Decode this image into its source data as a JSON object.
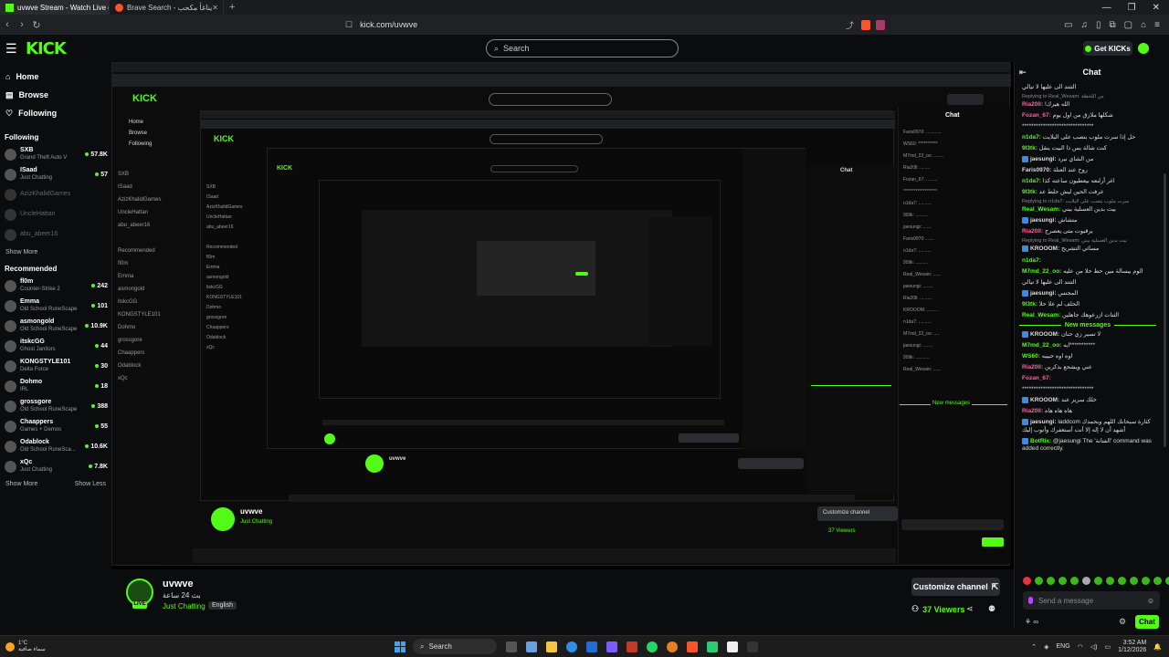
{
  "browser": {
    "tabs": [
      {
        "title": "uvwve Stream - Watch Live on K",
        "active": true
      },
      {
        "title": "Brave Search - يناغأ مكحب",
        "active": false
      }
    ],
    "new_tab": "+",
    "url": "kick.com/uvwve",
    "window_controls": [
      "—",
      "❐",
      "✕"
    ]
  },
  "header": {
    "logo": "KICK",
    "search_placeholder": "Search",
    "get_kicks": "Get KICKs"
  },
  "sidebar": {
    "nav": [
      {
        "label": "Home",
        "icon": "home-icon"
      },
      {
        "label": "Browse",
        "icon": "browse-icon"
      },
      {
        "label": "Following",
        "icon": "heart-icon"
      }
    ],
    "following_title": "Following",
    "following": [
      {
        "name": "SXB",
        "category": "Grand Theft Auto V",
        "viewers": "57.8K",
        "live": true
      },
      {
        "name": "ISaad",
        "category": "Just Chatting",
        "viewers": "57",
        "live": true
      },
      {
        "name": "AzizKhalidGames",
        "category": "",
        "viewers": "",
        "live": false
      },
      {
        "name": "UncleHattan",
        "category": "",
        "viewers": "",
        "live": false
      },
      {
        "name": "abu_abeer16",
        "category": "",
        "viewers": "",
        "live": false
      }
    ],
    "following_show_more": "Show More",
    "recommended_title": "Recommended",
    "recommended": [
      {
        "name": "fl0m",
        "category": "Counter-Strike 2",
        "viewers": "242"
      },
      {
        "name": "Emma",
        "category": "Old School RuneScape",
        "viewers": "101"
      },
      {
        "name": "asmongold",
        "category": "Old School RuneScape",
        "viewers": "10.9K"
      },
      {
        "name": "itskcGG",
        "category": "Ghost Janitors",
        "viewers": "44"
      },
      {
        "name": "KONGSTYLE101",
        "category": "Delta Force",
        "viewers": "30"
      },
      {
        "name": "Dohmo",
        "category": "IRL",
        "viewers": "18"
      },
      {
        "name": "grossgore",
        "category": "Old School RuneScape",
        "viewers": "388"
      },
      {
        "name": "Chaappers",
        "category": "Games + Demos",
        "viewers": "55"
      },
      {
        "name": "Odablock",
        "category": "Old School RuneSca...",
        "viewers": "10.6K"
      },
      {
        "name": "xQc",
        "category": "Just Chatting",
        "viewers": "7.8K"
      }
    ],
    "rec_show_more": "Show More",
    "rec_show_less": "Show Less"
  },
  "stream": {
    "streamer": "uvwve",
    "live_badge": "LIVE",
    "title": "بث 24 ساعة",
    "category": "Just Chatting",
    "language": "English",
    "customize": "Customize channel",
    "viewers": "37 Viewers"
  },
  "chat": {
    "title": "Chat",
    "messages": [
      {
        "reply": "",
        "user": "",
        "color": "#ddd",
        "text": "التتند الى عليها لا تيالي",
        "badge": false
      },
      {
        "reply": "Replying to Real_Wesam: من اللحظة",
        "user": "Ria20ll:",
        "color": "#ff5fa2",
        "text": "الله هيرك!",
        "badge": false
      },
      {
        "reply": "",
        "user": "Fozan_67:",
        "color": "#ff5fa2",
        "text": "شكلها ملازق من اول يوم",
        "badge": false
      },
      {
        "reply": "",
        "user": "",
        "color": "#ddd",
        "text": "*******************************",
        "badge": false
      },
      {
        "reply": "",
        "user": "n1da7:",
        "color": "#53fc18",
        "text": "حل إذا سرت ملوب بتصب على البلايت",
        "badge": false
      },
      {
        "reply": "",
        "user": "9l3tk:",
        "color": "#53fc18",
        "text": "كنت شالة بس ذا البيت ينقل",
        "badge": false
      },
      {
        "reply": "",
        "user": "jaesungi:",
        "color": "#ddd",
        "text": "من الشاي نيرد",
        "badge": true
      },
      {
        "reply": "",
        "user": "Faris0970:",
        "color": "#ddd",
        "text": "روح عند العنلة",
        "badge": false
      },
      {
        "reply": "",
        "user": "n1da7:",
        "color": "#53fc18",
        "text": "اغر أرلنعه بيعطيون ساعته كذا",
        "badge": false
      },
      {
        "reply": "",
        "user": "9l3tk:",
        "color": "#53fc18",
        "text": "عرفت الحين ليش حلط عد",
        "badge": false
      },
      {
        "reply": "Replying to n1da7: سرت ملوب بتصب على البلايت",
        "user": "Real_Wesam:",
        "color": "#53fc18",
        "text": "بيت بدين العسلية بيني",
        "badge": false
      },
      {
        "reply": "",
        "user": "jaesungi:",
        "color": "#ddd",
        "text": "متشاش",
        "badge": true
      },
      {
        "reply": "",
        "user": "Ria20ll:",
        "color": "#ff5fa2",
        "text": "يرقيوت متى يعصرج",
        "badge": false
      },
      {
        "reply": "Replying to Real_Wesam: بيت بدين العسلية بيني",
        "user": "KROOOM:",
        "color": "#ddd",
        "text": "مسائي التشريح",
        "badge": true
      },
      {
        "reply": "",
        "user": "n1da7:",
        "color": "#53fc18",
        "text": "",
        "badge": false
      },
      {
        "reply": "",
        "user": "M7md_22_oo:",
        "color": "#53fc18",
        "text": "الوم بيسالة مين حط حلا من عليه",
        "badge": false
      },
      {
        "reply": "",
        "user": "",
        "color": "#ddd",
        "text": "التتند الى عليها لا تيالي",
        "badge": false
      },
      {
        "reply": "",
        "user": "jaesungi:",
        "color": "#ddd",
        "text": "المجنس",
        "badge": true
      },
      {
        "reply": "",
        "user": "9l3tk:",
        "color": "#53fc18",
        "text": "الحلف لم علا حلا",
        "badge": false
      },
      {
        "reply": "",
        "user": "Real_Wesam:",
        "color": "#53fc18",
        "text": "الثنات ازرعوهك جاهلين",
        "badge": false
      }
    ],
    "new_messages": "New messages",
    "new": [
      {
        "user": "KROOOM:",
        "color": "#ddd",
        "text": "لا تسير زي حنان",
        "badge": true
      },
      {
        "user": "M7md_22_oo:",
        "color": "#53fc18",
        "text": "***********ايه",
        "badge": false
      },
      {
        "user": "WS60:",
        "color": "#53fc18",
        "text": "اوه اوه حبيبه",
        "badge": false
      },
      {
        "user": "Ria20ll:",
        "color": "#ff5fa2",
        "text": "عني ويشحع بذكرين",
        "badge": false
      },
      {
        "user": "Fozan_67:",
        "color": "#ff5fa2",
        "text": "",
        "badge": false
      },
      {
        "user": "",
        "color": "#ddd",
        "text": "*******************************",
        "badge": false
      },
      {
        "user": "KROOOM:",
        "color": "#ddd",
        "text": "خلك سريز عند",
        "badge": true
      },
      {
        "user": "Ria20ll:",
        "color": "#ff5fa2",
        "text": "هاه هاه هاه",
        "badge": false
      },
      {
        "user": "jaesungi:",
        "color": "#ddd",
        "text": "laddcom كثارة سبحانك اللهم وبحمدك أشهد أن لا إله إلا أنت أستغفرك وأتوب إليك",
        "badge": true
      },
      {
        "user": "BotRix:",
        "color": "#53fc18",
        "text": "@jaesungi The 'الفنانة' command was added correctly.",
        "badge": true
      }
    ],
    "input_placeholder": "Send a message",
    "send": "Chat"
  },
  "taskbar": {
    "weather_temp": "1°C",
    "weather_desc": "سماء صافية",
    "search": "Search",
    "lang": "ENG",
    "time": "3:52 AM",
    "date": "1/12/2026"
  }
}
